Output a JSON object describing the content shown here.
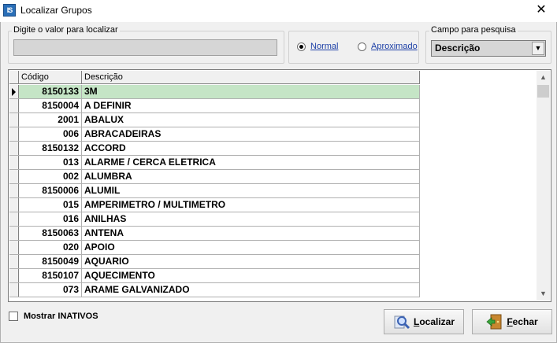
{
  "window": {
    "title": "Localizar Grupos",
    "app_icon_text": "IS",
    "close_glyph": "✕"
  },
  "search": {
    "legend": "Digite o valor para localizar",
    "value": ""
  },
  "mode": {
    "normal_label": "Normal",
    "aproximado_label": "Aproximado",
    "selected": "normal"
  },
  "field": {
    "legend": "Campo para pesquisa",
    "selected": "Descrição"
  },
  "grid": {
    "columns": [
      "Código",
      "Descrição"
    ],
    "rows": [
      {
        "code": "8150133",
        "desc": "3M",
        "selected": true
      },
      {
        "code": "8150004",
        "desc": "A DEFINIR"
      },
      {
        "code": "2001",
        "desc": "ABALUX"
      },
      {
        "code": "006",
        "desc": "ABRACADEIRAS"
      },
      {
        "code": "8150132",
        "desc": "ACCORD"
      },
      {
        "code": "013",
        "desc": "ALARME / CERCA ELETRICA"
      },
      {
        "code": "002",
        "desc": "ALUMBRA"
      },
      {
        "code": "8150006",
        "desc": "ALUMIL"
      },
      {
        "code": "015",
        "desc": "AMPERIMETRO / MULTIMETRO"
      },
      {
        "code": "016",
        "desc": "ANILHAS"
      },
      {
        "code": "8150063",
        "desc": "ANTENA"
      },
      {
        "code": "020",
        "desc": "APOIO"
      },
      {
        "code": "8150049",
        "desc": "AQUARIO"
      },
      {
        "code": "8150107",
        "desc": "AQUECIMENTO"
      },
      {
        "code": "073",
        "desc": "ARAME GALVANIZADO"
      }
    ]
  },
  "options": {
    "show_inactive_label": "Mostrar INATIVOS",
    "show_inactive_checked": false
  },
  "buttons": {
    "search_label": "Localizar",
    "close_label": "Fechar"
  },
  "colors": {
    "selected_row": "#c5e5c6",
    "link": "#1c3fa6"
  }
}
